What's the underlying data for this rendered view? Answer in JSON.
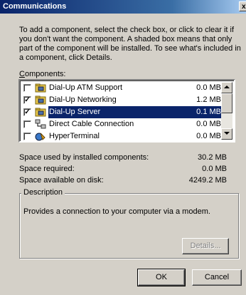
{
  "window": {
    "title": "Communications",
    "close_glyph": "x"
  },
  "intro_text": "To add a component, select the check box, or click to clear it if you don't want the component. A shaded box means that only part of the component will be installed. To see what's included in a component, click Details.",
  "components_label": {
    "mnemonic": "C",
    "rest": "omponents:"
  },
  "components": [
    {
      "name": "Dial-Up ATM Support",
      "size": "0.0 MB",
      "checked": false,
      "selected": false,
      "icon": "folder-icon"
    },
    {
      "name": "Dial-Up Networking",
      "size": "1.2 MB",
      "checked": true,
      "selected": false,
      "icon": "folder-icon"
    },
    {
      "name": "Dial-Up Server",
      "size": "0.1 MB",
      "checked": true,
      "selected": true,
      "icon": "folder-icon"
    },
    {
      "name": "Direct Cable Connection",
      "size": "0.0 MB",
      "checked": false,
      "selected": false,
      "icon": "cable-connection-icon"
    },
    {
      "name": "HyperTerminal",
      "size": "0.0 MB",
      "checked": false,
      "selected": false,
      "icon": "hyperterminal-icon"
    }
  ],
  "space": {
    "used_label": "Space used by installed components:",
    "used_value": "30.2 MB",
    "required_label": "Space required:",
    "required_value": "0.0 MB",
    "available_label": "Space available on disk:",
    "available_value": "4249.2 MB"
  },
  "description": {
    "title": "Description",
    "text": "Provides a connection to your computer via a modem."
  },
  "buttons": {
    "details": "Details...",
    "ok": "OK",
    "cancel": "Cancel"
  },
  "colors": {
    "face": "#d4d0c8",
    "selection": "#0a246a",
    "title_start": "#0a246a"
  }
}
